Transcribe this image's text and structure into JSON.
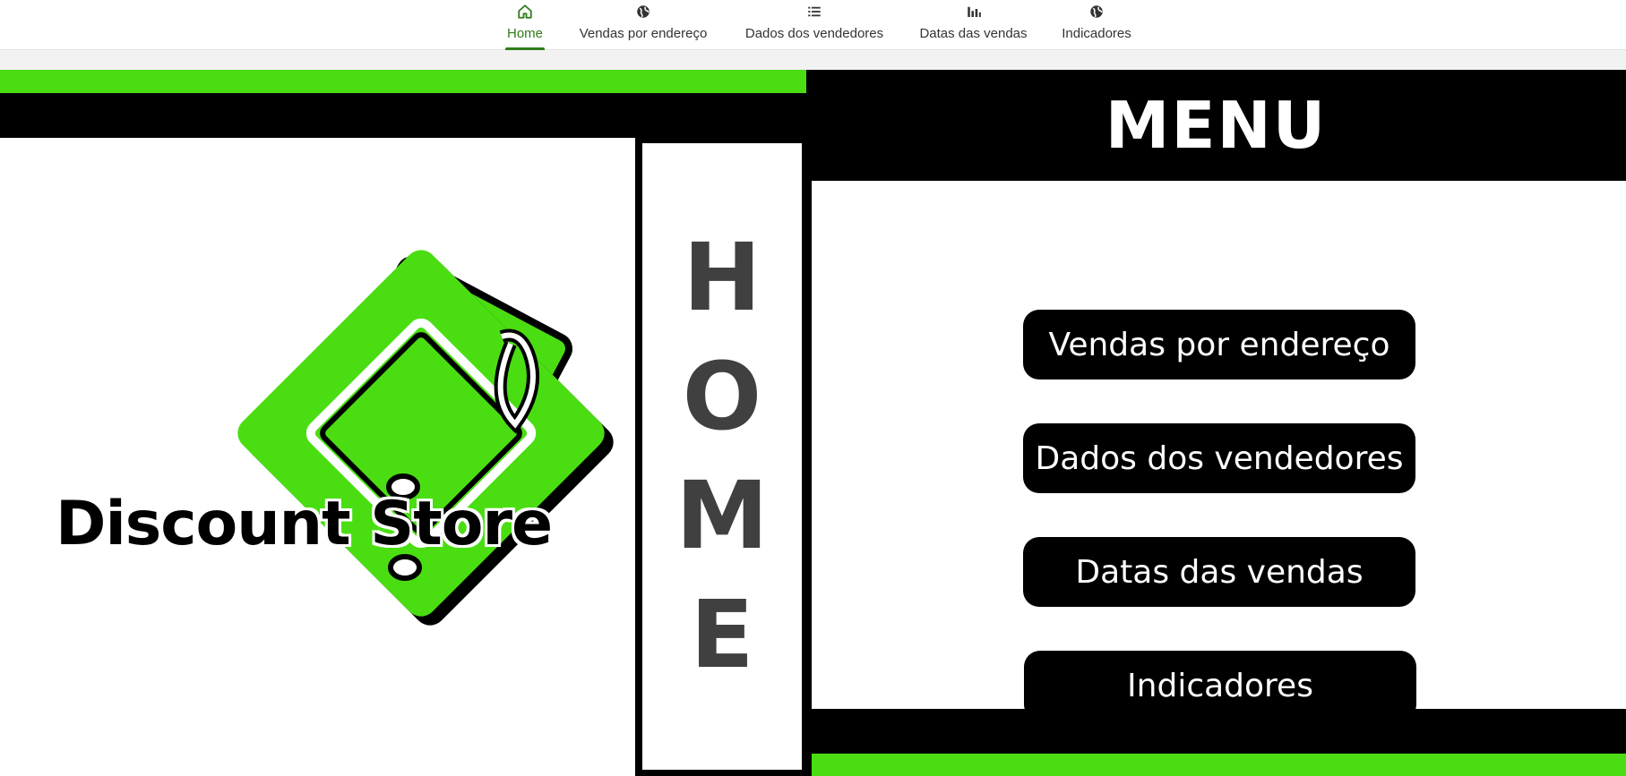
{
  "nav": {
    "tabs": [
      {
        "label": "Home",
        "icon": "home-icon",
        "active": true
      },
      {
        "label": "Vendas por endereço",
        "icon": "globe-icon",
        "active": false
      },
      {
        "label": "Dados dos vendedores",
        "icon": "list-icon",
        "active": false
      },
      {
        "label": "Datas das vendas",
        "icon": "bar-chart-icon",
        "active": false
      },
      {
        "label": "Indicadores",
        "icon": "globe-icon",
        "active": false
      }
    ]
  },
  "colors": {
    "accent_green": "#4ade12",
    "active_tab": "#2e7d1a",
    "black": "#000000",
    "home_letters": "#404040"
  },
  "logo": {
    "store_name": "Discount Store",
    "icon": "price-tag-icon"
  },
  "home_column": {
    "letters": [
      "H",
      "O",
      "M",
      "E"
    ]
  },
  "menu": {
    "title": "MENU",
    "buttons": [
      {
        "label": "Vendas por endereço"
      },
      {
        "label": "Dados dos vendedores"
      },
      {
        "label": "Datas das vendas"
      },
      {
        "label": "Indicadores"
      }
    ]
  }
}
